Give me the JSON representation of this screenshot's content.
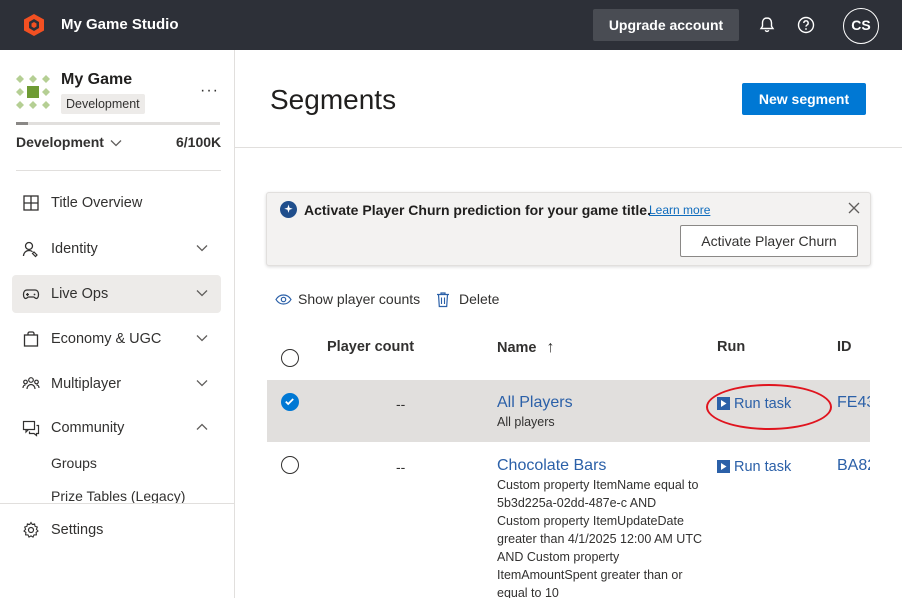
{
  "header": {
    "app_title": "My Game Studio",
    "upgrade_label": "Upgrade account",
    "avatar_initials": "CS"
  },
  "sidebar": {
    "game_name": "My Game",
    "env_badge": "Development",
    "more_label": "···",
    "env_select": "Development",
    "usage": "6/100K",
    "usage_fraction": 0.06,
    "items": [
      {
        "label": "Title Overview",
        "icon": "grid-icon",
        "chevron": "none"
      },
      {
        "label": "Identity",
        "icon": "identity-icon",
        "chevron": "down"
      },
      {
        "label": "Live Ops",
        "icon": "gamepad-icon",
        "chevron": "down",
        "selected": true
      },
      {
        "label": "Economy & UGC",
        "icon": "economy-icon",
        "chevron": "down"
      },
      {
        "label": "Multiplayer",
        "icon": "multiplayer-icon",
        "chevron": "down"
      },
      {
        "label": "Community",
        "icon": "community-icon",
        "chevron": "up"
      }
    ],
    "sub_items": [
      "Groups",
      "Prize Tables (Legacy)"
    ],
    "settings_label": "Settings"
  },
  "main": {
    "title": "Segments",
    "new_segment_label": "New segment",
    "banner": {
      "text": "Activate Player Churn prediction for your game title.",
      "link": "Learn more",
      "button": "Activate Player Churn"
    },
    "toolbar": {
      "show_counts": "Show player counts",
      "delete": "Delete"
    },
    "table": {
      "headers": {
        "player_count": "Player count",
        "name": "Name",
        "sort_arrow": "↑",
        "run": "Run",
        "id": "ID"
      },
      "rows": [
        {
          "selected": true,
          "player_count": "--",
          "name": "All Players",
          "description": "All players",
          "run": "Run task",
          "id": "FE43"
        },
        {
          "selected": false,
          "player_count": "--",
          "name": "Chocolate Bars",
          "description": "Custom property ItemName equal to 5b3d225a-02dd-487e-c AND Custom property ItemUpdateDate greater than 4/1/2025 12:00 AM UTC AND Custom property ItemAmountSpent greater than or equal to 10",
          "run": "Run task",
          "id": "BA82"
        }
      ]
    }
  },
  "colors": {
    "topbar": "#2d3038",
    "accent": "#0078d4",
    "link": "#2b60a8",
    "logo": "#f25022",
    "annotation": "#e0141e"
  }
}
